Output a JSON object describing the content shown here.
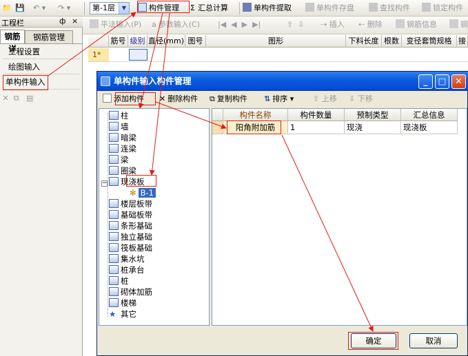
{
  "toolbar": {
    "floor": "第-1层",
    "component_mgmt": "构件管理",
    "summary_calc": "汇总计算",
    "single_extract": "单构件提取",
    "single_save": "单构件存盘",
    "find": "查找构件",
    "lock": "锁定构件"
  },
  "toolbar2": {
    "flat_input": "平法输入(P)",
    "param_input": "参数输入(C)",
    "insert": "插入",
    "delete": "删除",
    "rebar_info": "钢筋信息",
    "rebar": "钢"
  },
  "left_panel": {
    "title": "工程栏",
    "pin": "ф",
    "close": "×",
    "tabs": [
      "钢筋详",
      "钢筋管理"
    ],
    "items": [
      "工程设置",
      "绘图输入",
      "单构件输入"
    ]
  },
  "grid": {
    "headers": [
      "筋号",
      "级别",
      "直径(mm)",
      "图号",
      "图形",
      "下料长度",
      "根数",
      "变径套筒规格",
      "接"
    ],
    "row_label": "1*"
  },
  "dialog": {
    "title": "单构件输入构件管理",
    "toolbar": {
      "add": "添加构件",
      "delete": "删除构件",
      "copy": "复制构件",
      "sort": "排序",
      "up": "上移",
      "down": "下移"
    },
    "tree": [
      "柱",
      "墙",
      "暗梁",
      "连梁",
      "梁",
      "圈梁",
      "现浇板",
      "B-1",
      "楼层板带",
      "基础板带",
      "条形基础",
      "独立基础",
      "筏板基础",
      "集水坑",
      "桩承台",
      "桩",
      "砌体加筋",
      "楼梯",
      "其它"
    ],
    "table": {
      "headers": [
        "构件名称",
        "构件数量",
        "预制类型",
        "汇总信息"
      ],
      "rows": [
        [
          "阳角附加筋",
          "1",
          "现浇",
          "现浇板"
        ]
      ]
    },
    "ok": "确定",
    "cancel": "取消"
  },
  "colors": {
    "accent": "#0a5fe0",
    "annotation": "#e21a1a"
  }
}
